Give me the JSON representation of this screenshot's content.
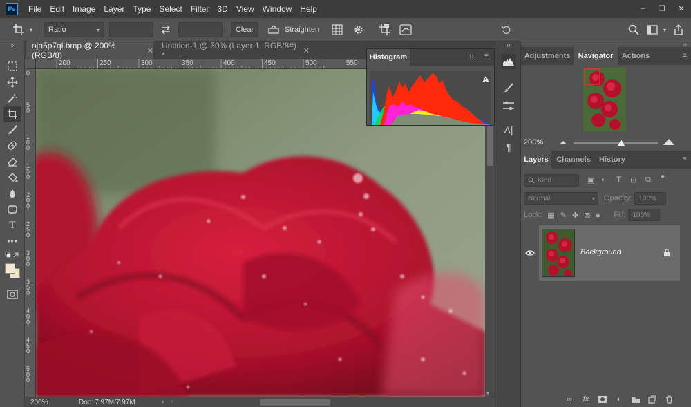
{
  "app": {
    "logo_text": "Ps",
    "menu": [
      "File",
      "Edit",
      "Image",
      "Layer",
      "Type",
      "Select",
      "Filter",
      "3D",
      "View",
      "Window",
      "Help"
    ],
    "window_controls": [
      "–",
      "❐",
      "✕"
    ]
  },
  "options_bar": {
    "ratio_value": "Ratio",
    "clear_label": "Clear",
    "straighten_label": "Straighten"
  },
  "documents": {
    "tabs": [
      {
        "label": "ojn5p7ql.bmp @ 200% (RGB/8)",
        "active": true
      },
      {
        "label": "Untitled-1 @ 50% (Layer 1, RGB/8#) *",
        "active": false
      }
    ],
    "ruler_h": [
      "200",
      "250",
      "300",
      "350",
      "400",
      "450",
      "500",
      "550"
    ],
    "ruler_v": [
      "0",
      "5\n0",
      "1\n0\n0",
      "1\n5\n0",
      "2\n0\n0",
      "2\n5\n0",
      "3\n0\n0",
      "3\n5\n0",
      "4\n0\n0",
      "4\n5\n0",
      "5\n0\n0",
      "5\n5\n0"
    ]
  },
  "status": {
    "zoom": "200%",
    "doc_info": "Doc: 7.97M/7.97M"
  },
  "histogram_panel": {
    "tab_label": "Histogram"
  },
  "right_panels": {
    "top_tabs": [
      "Adjustments",
      "Navigator",
      "Actions"
    ],
    "active_top_tab": "Navigator",
    "navigator_zoom": "200%",
    "layer_tabs": [
      "Layers",
      "Channels",
      "History"
    ],
    "active_layer_tab": "Layers",
    "kind_placeholder": "Kind",
    "blend_mode": "Normal",
    "opacity_label": "Opacity:",
    "opacity_value": "100%",
    "lock_label": "Lock:",
    "fill_label": "Fill:",
    "fill_value": "100%",
    "layers": [
      {
        "name": "Background",
        "visible": true,
        "locked": true
      }
    ]
  }
}
